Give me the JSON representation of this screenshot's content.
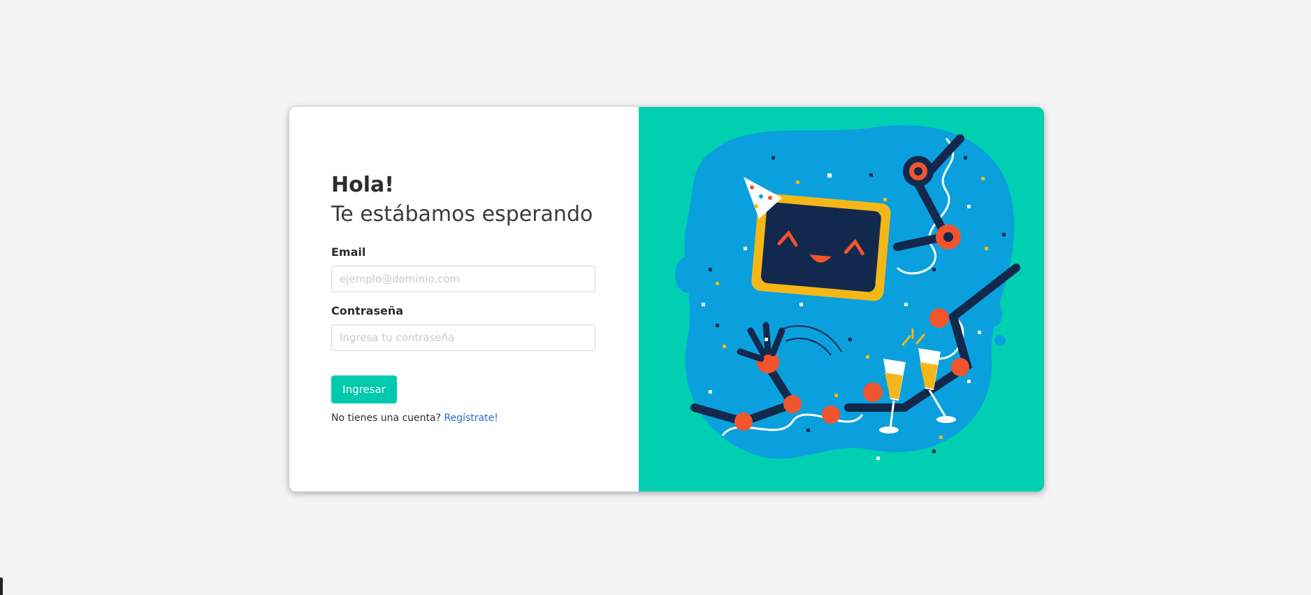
{
  "greeting": {
    "title": "Hola!",
    "subtitle": "Te estábamos esperando"
  },
  "form": {
    "email_label": "Email",
    "email_placeholder": "ejemplo@dominio.com",
    "password_label": "Contraseña",
    "password_placeholder": "Ingresa tu contraseña",
    "submit_label": "Ingresar",
    "no_account_text": "No tienes una cuenta?",
    "register_link": "Regístrate!"
  },
  "colors": {
    "accent": "#00c9ae",
    "panel": "#00cfb2",
    "link": "#1f6fd1",
    "blob": "#0aa0dd"
  }
}
